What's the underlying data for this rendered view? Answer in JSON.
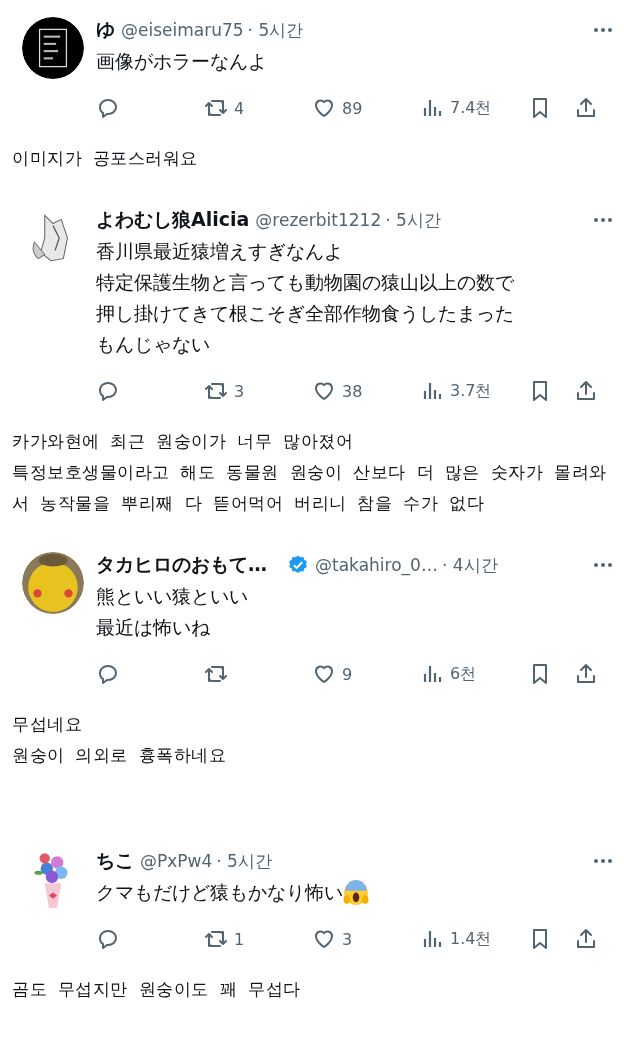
{
  "replies": [
    {
      "display_name": "ゆ",
      "verified": false,
      "handle": "@eiseimaru75",
      "time": "· 5시간",
      "text_lines": [
        "画像がホラーなんよ"
      ],
      "emoji": false,
      "stats": {
        "retweets": "4",
        "likes": "89",
        "views": "7.4천"
      },
      "translation": [
        "이미지가 공포스러워요"
      ]
    },
    {
      "display_name": "よわむし狼Alicia",
      "verified": false,
      "handle": "@rezerbit1212",
      "time": "· 5시간",
      "text_lines": [
        "香川県最近猿増えすぎなんよ",
        "特定保護生物と言っても動物園の猿山以上の数で",
        "押し掛けてきて根こそぎ全部作物食うしたまった",
        "もんじゃない"
      ],
      "emoji": false,
      "stats": {
        "retweets": "3",
        "likes": "38",
        "views": "3.7천"
      },
      "translation": [
        "카가와현에 최근 원숭이가 너무 많아졌어",
        "특정보호생물이라고 해도 동물원 원숭이 산보다 더 많은 숫자가 몰려와서 농작물을 뿌리째 다 뜯어먹어 버리니 참을 수가 없다"
      ]
    },
    {
      "display_name": "タカヒロのおもて…",
      "verified": true,
      "handle": "@takahiro_0…",
      "time": "· 4시간",
      "text_lines": [
        "熊といい猿といい",
        "最近は怖いね"
      ],
      "emoji": false,
      "stats": {
        "likes": "9",
        "views": "6천"
      },
      "translation": [
        "무섭네요",
        "원숭이 의외로 흉폭하네요"
      ]
    },
    {
      "display_name": "ちこ",
      "verified": false,
      "handle": "@PxPw4",
      "time": "· 5시간",
      "text_lines": [
        "クマもだけど猿もかなり怖い"
      ],
      "emoji": true,
      "stats": {
        "retweets": "1",
        "likes": "3",
        "views": "1.4천"
      },
      "translation": [
        "곰도 무섭지만 원숭이도 꽤 무섭다"
      ]
    }
  ]
}
